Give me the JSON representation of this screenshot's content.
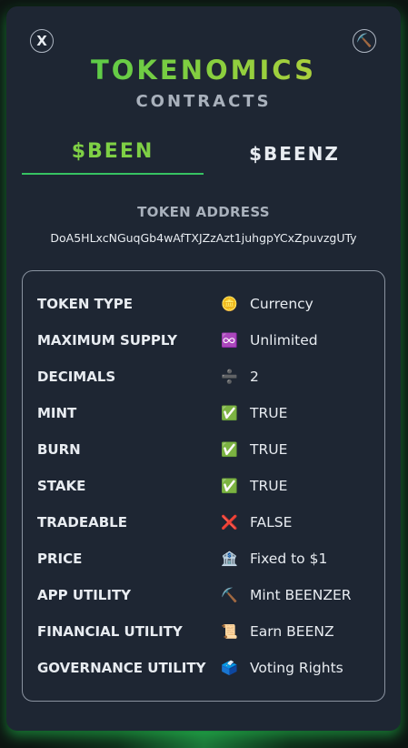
{
  "header": {
    "close_label": "X",
    "pick_icon": "⛏️",
    "title": "TOKENOMICS",
    "subtitle": "CONTRACTS"
  },
  "tabs": [
    {
      "label": "$BEEN",
      "active": true
    },
    {
      "label": "$BEENZ",
      "active": false
    }
  ],
  "token": {
    "address_label": "TOKEN ADDRESS",
    "address": "DoA5HLxcNGuqGb4wAfTXJZzAzt1juhgpYCxZpuvzgUTy"
  },
  "properties": [
    {
      "label": "TOKEN TYPE",
      "icon": "🪙",
      "icon_name": "coin-icon",
      "value": "Currency"
    },
    {
      "label": "MAXIMUM SUPPLY",
      "icon": "♾️",
      "icon_name": "infinity-icon",
      "value": "Unlimited"
    },
    {
      "label": "DECIMALS",
      "icon": "➗",
      "icon_name": "divide-icon",
      "value": "2"
    },
    {
      "label": "MINT",
      "icon": "✅",
      "icon_name": "check-icon",
      "value": "TRUE"
    },
    {
      "label": "BURN",
      "icon": "✅",
      "icon_name": "check-icon",
      "value": "TRUE"
    },
    {
      "label": "STAKE",
      "icon": "✅",
      "icon_name": "check-icon",
      "value": "TRUE"
    },
    {
      "label": "TRADEABLE",
      "icon": "❌",
      "icon_name": "cross-icon",
      "value": "FALSE"
    },
    {
      "label": "PRICE",
      "icon": "🏦",
      "icon_name": "bank-icon",
      "value": "Fixed to $1"
    },
    {
      "label": "APP UTILITY",
      "icon": "⛏️",
      "icon_name": "pickaxe-icon",
      "value": "Mint BEENZER"
    },
    {
      "label": "FINANCIAL UTILITY",
      "icon": "📜",
      "icon_name": "scroll-icon",
      "value": "Earn BEENZ"
    },
    {
      "label": "GOVERNANCE UTILITY",
      "icon": "🗳️",
      "icon_name": "ballot-box-icon",
      "value": "Voting Rights"
    }
  ],
  "colors": {
    "card_bg": "#1e2633",
    "accent_green": "#37c262",
    "title_gradient_start": "#3fc94e",
    "title_gradient_end": "#c9d13c",
    "muted_text": "#a9b1bc"
  }
}
